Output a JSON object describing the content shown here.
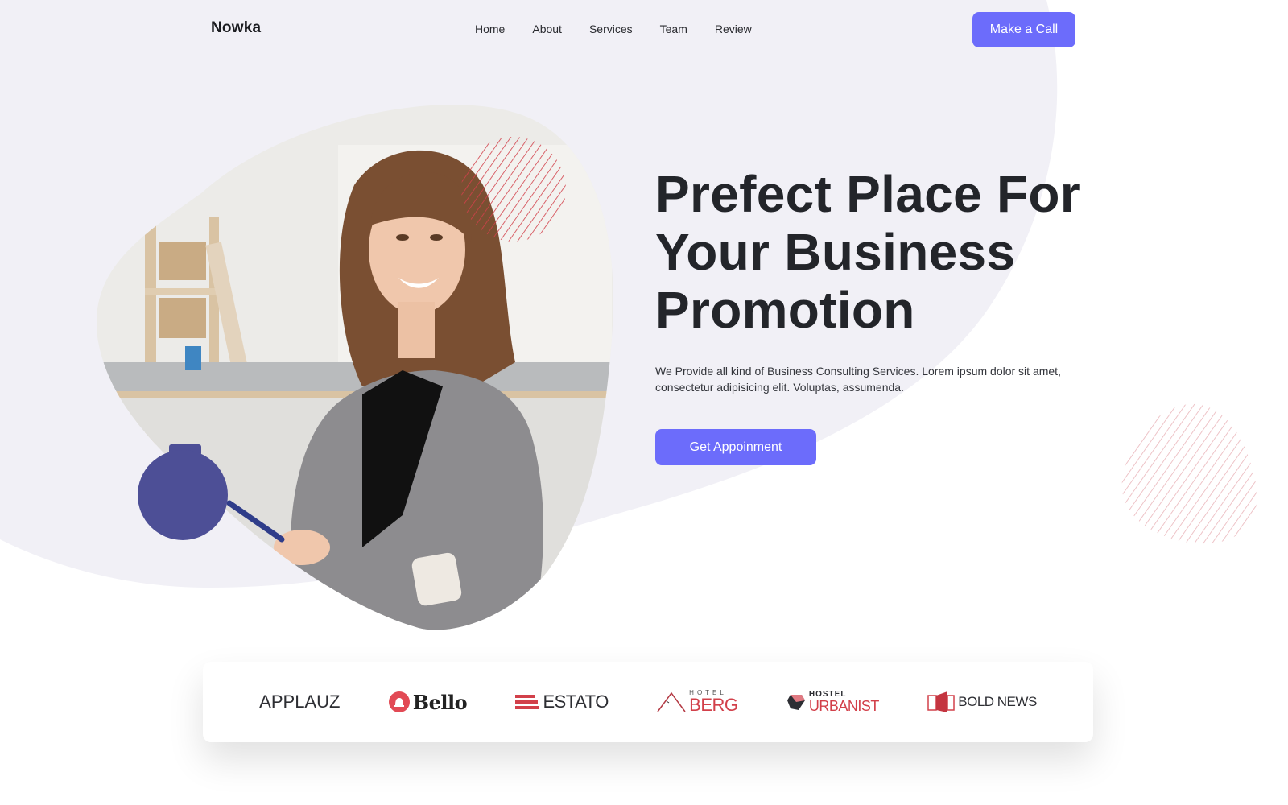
{
  "header": {
    "logo": "Nowka",
    "nav": [
      {
        "label": "Home"
      },
      {
        "label": "About"
      },
      {
        "label": "Services"
      },
      {
        "label": "Team"
      },
      {
        "label": "Review"
      }
    ],
    "cta_label": "Make a Call"
  },
  "hero": {
    "title_lines": [
      "Prefect Place For",
      "Your Business",
      "Promotion"
    ],
    "description": "We Provide all kind of Business Consulting Services. Lorem ipsum dolor sit amet, consectetur adipisicing elit. Voluptas, assumenda.",
    "button_label": "Get Appoinment",
    "image_alt": "Smiling businesswoman in grey blazer holding a pen at an office desk"
  },
  "brands": [
    {
      "name": "APPLAUZ"
    },
    {
      "name": "Bello"
    },
    {
      "name": "ESTATO"
    },
    {
      "name_small": "HOTEL",
      "name": "BERG"
    },
    {
      "name_small": "HOSTEL",
      "name": "URBANIST"
    },
    {
      "name": "BOLD NEWS"
    }
  ],
  "colors": {
    "accent": "#6c6cfb",
    "accent_dark": "#4d4f96",
    "hatch_red": "#d2404a",
    "bg_blob": "#f1f0f6",
    "text_dark": "#23252a"
  }
}
